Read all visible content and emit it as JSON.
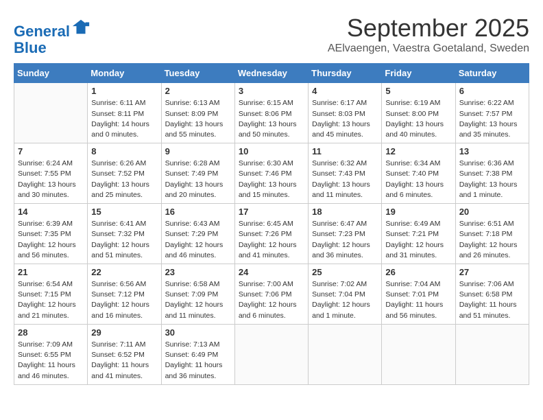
{
  "logo": {
    "line1": "General",
    "line2": "Blue"
  },
  "title": "September 2025",
  "subtitle": "AElvaengen, Vaestra Goetaland, Sweden",
  "days_of_week": [
    "Sunday",
    "Monday",
    "Tuesday",
    "Wednesday",
    "Thursday",
    "Friday",
    "Saturday"
  ],
  "weeks": [
    [
      {
        "day": "",
        "info": ""
      },
      {
        "day": "1",
        "info": "Sunrise: 6:11 AM\nSunset: 8:11 PM\nDaylight: 14 hours\nand 0 minutes."
      },
      {
        "day": "2",
        "info": "Sunrise: 6:13 AM\nSunset: 8:09 PM\nDaylight: 13 hours\nand 55 minutes."
      },
      {
        "day": "3",
        "info": "Sunrise: 6:15 AM\nSunset: 8:06 PM\nDaylight: 13 hours\nand 50 minutes."
      },
      {
        "day": "4",
        "info": "Sunrise: 6:17 AM\nSunset: 8:03 PM\nDaylight: 13 hours\nand 45 minutes."
      },
      {
        "day": "5",
        "info": "Sunrise: 6:19 AM\nSunset: 8:00 PM\nDaylight: 13 hours\nand 40 minutes."
      },
      {
        "day": "6",
        "info": "Sunrise: 6:22 AM\nSunset: 7:57 PM\nDaylight: 13 hours\nand 35 minutes."
      }
    ],
    [
      {
        "day": "7",
        "info": "Sunrise: 6:24 AM\nSunset: 7:55 PM\nDaylight: 13 hours\nand 30 minutes."
      },
      {
        "day": "8",
        "info": "Sunrise: 6:26 AM\nSunset: 7:52 PM\nDaylight: 13 hours\nand 25 minutes."
      },
      {
        "day": "9",
        "info": "Sunrise: 6:28 AM\nSunset: 7:49 PM\nDaylight: 13 hours\nand 20 minutes."
      },
      {
        "day": "10",
        "info": "Sunrise: 6:30 AM\nSunset: 7:46 PM\nDaylight: 13 hours\nand 15 minutes."
      },
      {
        "day": "11",
        "info": "Sunrise: 6:32 AM\nSunset: 7:43 PM\nDaylight: 13 hours\nand 11 minutes."
      },
      {
        "day": "12",
        "info": "Sunrise: 6:34 AM\nSunset: 7:40 PM\nDaylight: 13 hours\nand 6 minutes."
      },
      {
        "day": "13",
        "info": "Sunrise: 6:36 AM\nSunset: 7:38 PM\nDaylight: 13 hours\nand 1 minute."
      }
    ],
    [
      {
        "day": "14",
        "info": "Sunrise: 6:39 AM\nSunset: 7:35 PM\nDaylight: 12 hours\nand 56 minutes."
      },
      {
        "day": "15",
        "info": "Sunrise: 6:41 AM\nSunset: 7:32 PM\nDaylight: 12 hours\nand 51 minutes."
      },
      {
        "day": "16",
        "info": "Sunrise: 6:43 AM\nSunset: 7:29 PM\nDaylight: 12 hours\nand 46 minutes."
      },
      {
        "day": "17",
        "info": "Sunrise: 6:45 AM\nSunset: 7:26 PM\nDaylight: 12 hours\nand 41 minutes."
      },
      {
        "day": "18",
        "info": "Sunrise: 6:47 AM\nSunset: 7:23 PM\nDaylight: 12 hours\nand 36 minutes."
      },
      {
        "day": "19",
        "info": "Sunrise: 6:49 AM\nSunset: 7:21 PM\nDaylight: 12 hours\nand 31 minutes."
      },
      {
        "day": "20",
        "info": "Sunrise: 6:51 AM\nSunset: 7:18 PM\nDaylight: 12 hours\nand 26 minutes."
      }
    ],
    [
      {
        "day": "21",
        "info": "Sunrise: 6:54 AM\nSunset: 7:15 PM\nDaylight: 12 hours\nand 21 minutes."
      },
      {
        "day": "22",
        "info": "Sunrise: 6:56 AM\nSunset: 7:12 PM\nDaylight: 12 hours\nand 16 minutes."
      },
      {
        "day": "23",
        "info": "Sunrise: 6:58 AM\nSunset: 7:09 PM\nDaylight: 12 hours\nand 11 minutes."
      },
      {
        "day": "24",
        "info": "Sunrise: 7:00 AM\nSunset: 7:06 PM\nDaylight: 12 hours\nand 6 minutes."
      },
      {
        "day": "25",
        "info": "Sunrise: 7:02 AM\nSunset: 7:04 PM\nDaylight: 12 hours\nand 1 minute."
      },
      {
        "day": "26",
        "info": "Sunrise: 7:04 AM\nSunset: 7:01 PM\nDaylight: 11 hours\nand 56 minutes."
      },
      {
        "day": "27",
        "info": "Sunrise: 7:06 AM\nSunset: 6:58 PM\nDaylight: 11 hours\nand 51 minutes."
      }
    ],
    [
      {
        "day": "28",
        "info": "Sunrise: 7:09 AM\nSunset: 6:55 PM\nDaylight: 11 hours\nand 46 minutes."
      },
      {
        "day": "29",
        "info": "Sunrise: 7:11 AM\nSunset: 6:52 PM\nDaylight: 11 hours\nand 41 minutes."
      },
      {
        "day": "30",
        "info": "Sunrise: 7:13 AM\nSunset: 6:49 PM\nDaylight: 11 hours\nand 36 minutes."
      },
      {
        "day": "",
        "info": ""
      },
      {
        "day": "",
        "info": ""
      },
      {
        "day": "",
        "info": ""
      },
      {
        "day": "",
        "info": ""
      }
    ]
  ]
}
